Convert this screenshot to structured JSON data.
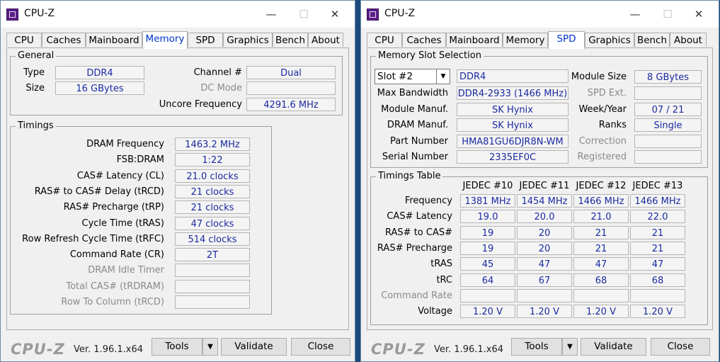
{
  "app": {
    "title": "CPU-Z",
    "logo": "CPU-Z",
    "version": "Ver. 1.96.1.x64"
  },
  "window_controls": {
    "minimize": "—",
    "maximize": "☐",
    "close": "✕"
  },
  "tabs": [
    "CPU",
    "Caches",
    "Mainboard",
    "Memory",
    "SPD",
    "Graphics",
    "Bench",
    "About"
  ],
  "memory": {
    "general_label": "General",
    "type_label": "Type",
    "type_value": "DDR4",
    "size_label": "Size",
    "size_value": "16 GBytes",
    "channel_label": "Channel #",
    "channel_value": "Dual",
    "dcmode_label": "DC Mode",
    "dcmode_value": "",
    "uncore_label": "Uncore Frequency",
    "uncore_value": "4291.6 MHz",
    "timings_label": "Timings",
    "timings": [
      {
        "label": "DRAM Frequency",
        "value": "1463.2 MHz",
        "enabled": true
      },
      {
        "label": "FSB:DRAM",
        "value": "1:22",
        "enabled": true
      },
      {
        "label": "CAS# Latency (CL)",
        "value": "21.0 clocks",
        "enabled": true
      },
      {
        "label": "RAS# to CAS# Delay (tRCD)",
        "value": "21 clocks",
        "enabled": true
      },
      {
        "label": "RAS# Precharge (tRP)",
        "value": "21 clocks",
        "enabled": true
      },
      {
        "label": "Cycle Time (tRAS)",
        "value": "47 clocks",
        "enabled": true
      },
      {
        "label": "Row Refresh Cycle Time (tRFC)",
        "value": "514 clocks",
        "enabled": true
      },
      {
        "label": "Command Rate (CR)",
        "value": "2T",
        "enabled": true
      },
      {
        "label": "DRAM Idle Timer",
        "value": "",
        "enabled": false
      },
      {
        "label": "Total CAS# (tRDRAM)",
        "value": "",
        "enabled": false
      },
      {
        "label": "Row To Column (tRCD)",
        "value": "",
        "enabled": false
      }
    ]
  },
  "spd": {
    "slot_group_label": "Memory Slot Selection",
    "slot_selected": "Slot #2",
    "module_type": "DDR4",
    "module_size_label": "Module Size",
    "module_size_value": "8 GBytes",
    "max_bw_label": "Max Bandwidth",
    "max_bw_value": "DDR4-2933 (1466 MHz)",
    "spd_ext_label": "SPD Ext.",
    "spd_ext_value": "",
    "module_manuf_label": "Module Manuf.",
    "module_manuf_value": "SK Hynix",
    "week_year_label": "Week/Year",
    "week_year_value": "07 / 21",
    "dram_manuf_label": "DRAM Manuf.",
    "dram_manuf_value": "SK Hynix",
    "ranks_label": "Ranks",
    "ranks_value": "Single",
    "part_label": "Part Number",
    "part_value": "HMA81GU6DJR8N-WM",
    "correction_label": "Correction",
    "correction_value": "",
    "serial_label": "Serial Number",
    "serial_value": "2335EF0C",
    "registered_label": "Registered",
    "registered_value": "",
    "table_label": "Timings Table",
    "columns": [
      "JEDEC #10",
      "JEDEC #11",
      "JEDEC #12",
      "JEDEC #13"
    ],
    "rows": [
      {
        "label": "Frequency",
        "values": [
          "1381 MHz",
          "1454 MHz",
          "1466 MHz",
          "1466 MHz"
        ],
        "enabled": true
      },
      {
        "label": "CAS# Latency",
        "values": [
          "19.0",
          "20.0",
          "21.0",
          "22.0"
        ],
        "enabled": true
      },
      {
        "label": "RAS# to CAS#",
        "values": [
          "19",
          "20",
          "21",
          "21"
        ],
        "enabled": true
      },
      {
        "label": "RAS# Precharge",
        "values": [
          "19",
          "20",
          "21",
          "21"
        ],
        "enabled": true
      },
      {
        "label": "tRAS",
        "values": [
          "45",
          "47",
          "47",
          "47"
        ],
        "enabled": true
      },
      {
        "label": "tRC",
        "values": [
          "64",
          "67",
          "68",
          "68"
        ],
        "enabled": true
      },
      {
        "label": "Command Rate",
        "values": [
          "",
          "",
          "",
          ""
        ],
        "enabled": false
      },
      {
        "label": "Voltage",
        "values": [
          "1.20 V",
          "1.20 V",
          "1.20 V",
          "1.20 V"
        ],
        "enabled": true
      }
    ]
  },
  "buttons": {
    "tools": "Tools",
    "tools_arrow": "▼",
    "validate": "Validate",
    "close": "Close",
    "dropdown_arrow": "▼"
  }
}
